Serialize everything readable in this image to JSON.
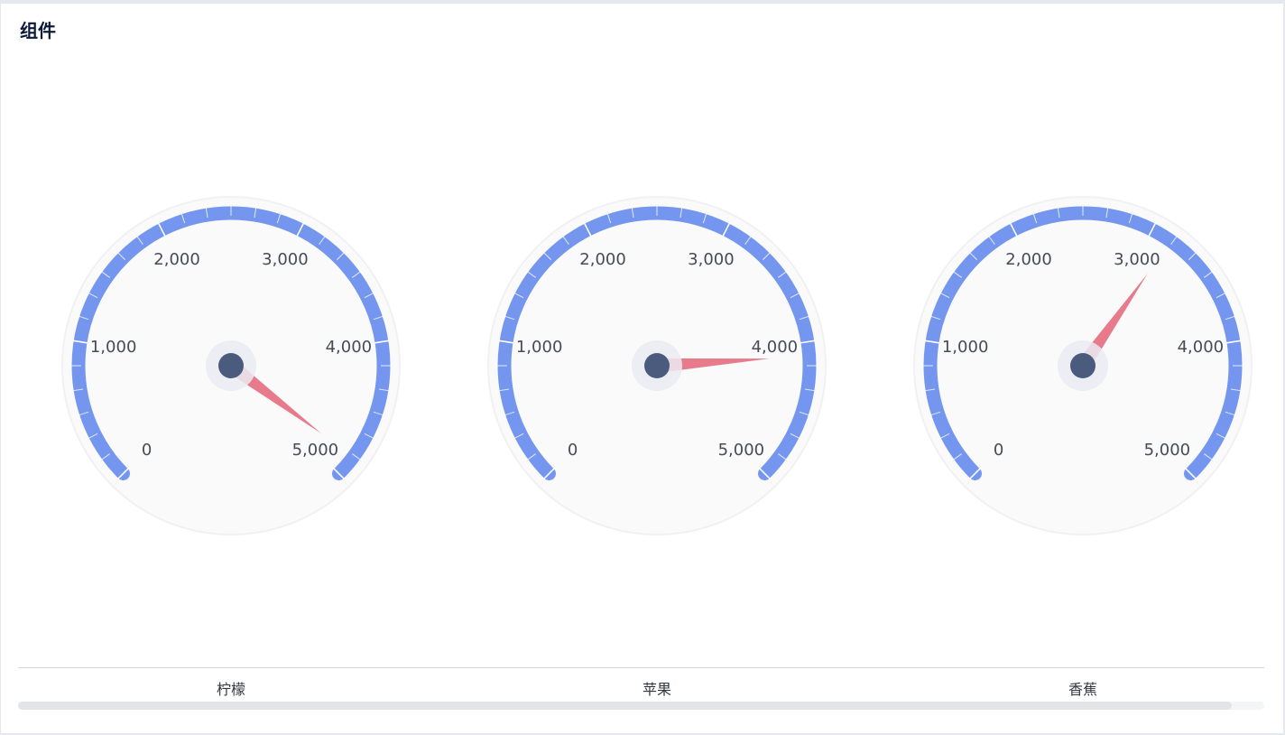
{
  "panel": {
    "title": "组件"
  },
  "chart_data": {
    "type": "gauge",
    "min": 0,
    "max": 5000,
    "tick_labels": [
      "0",
      "1,000",
      "2,000",
      "3,000",
      "4,000",
      "5,000"
    ],
    "categories": [
      "柠檬",
      "苹果",
      "香蕉"
    ],
    "values": [
      4850,
      4100,
      3150
    ]
  },
  "colors": {
    "arc": "#7496ef",
    "face": "#fafafa",
    "pointer": "#e87b8b",
    "hub": "#4a5b7e",
    "hub_ring": "#e9ebf2"
  },
  "scrollbar": {
    "visible_fraction": 0.974
  }
}
